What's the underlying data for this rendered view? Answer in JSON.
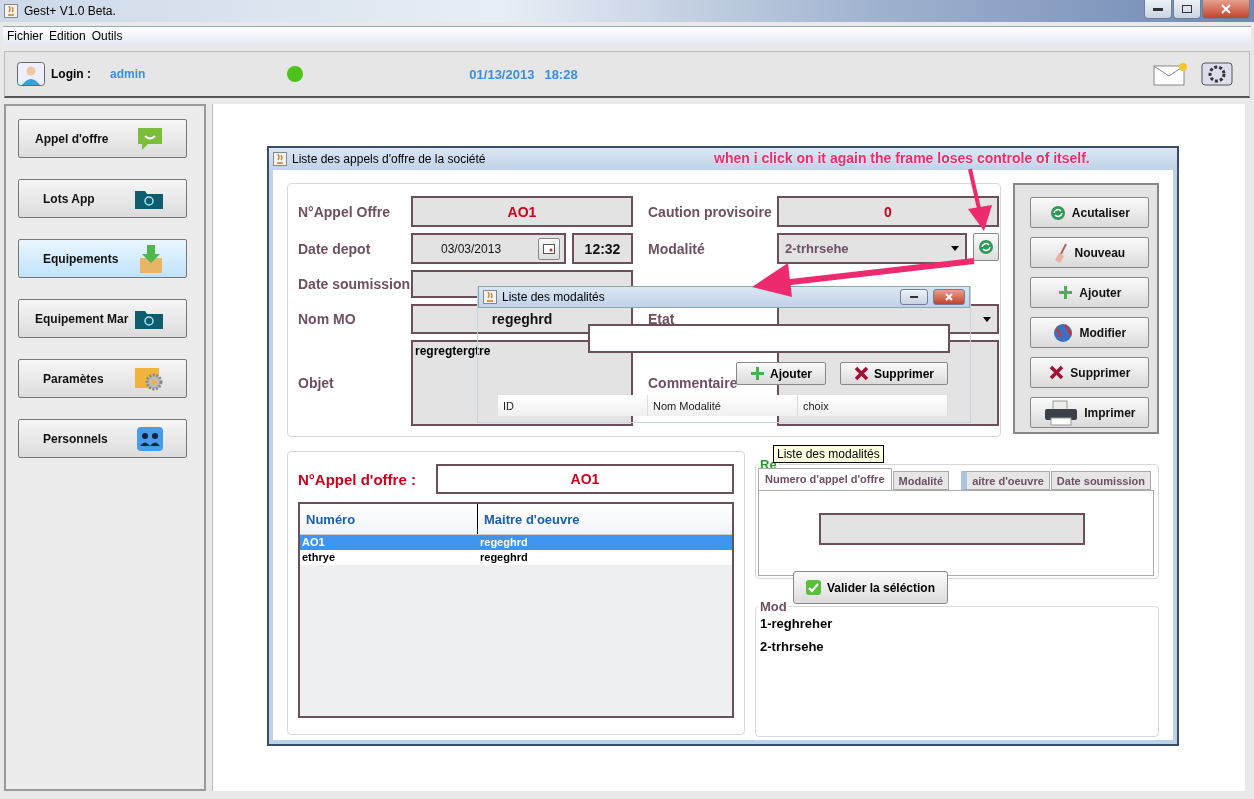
{
  "app_window": {
    "title": "Gest+ V1.0 Beta."
  },
  "menu": [
    "Fichier",
    "Edition",
    "Outils"
  ],
  "header": {
    "login_label": "Login :",
    "user": "admin",
    "date": "01/13/2013",
    "time": "18:28"
  },
  "sidebar": [
    {
      "label": "Appel d'offre",
      "kind": "chat",
      "selected": false
    },
    {
      "label": "Lots App",
      "kind": "folder",
      "selected": false
    },
    {
      "label": "Equipements",
      "kind": "box",
      "selected": true
    },
    {
      "label": "Equipement Mar",
      "kind": "folder",
      "selected": false
    },
    {
      "label": "Paramètes",
      "kind": "gear",
      "selected": false
    },
    {
      "label": "Personnels",
      "kind": "people",
      "selected": false
    }
  ],
  "frame": {
    "title": "Liste des appels d'offre de la société",
    "form": {
      "numero": {
        "label": "N°Appel Offre",
        "value": "AO1"
      },
      "date_depot": {
        "label": "Date depot",
        "value": "03/03/2013",
        "time": "12:32"
      },
      "date_soumission": {
        "label": "Date soumission"
      },
      "nom_mo": {
        "label": "Nom MO",
        "value": "regeghrd"
      },
      "objet": {
        "label": "Objet",
        "value": "regregtergtre"
      },
      "caution": {
        "label": "Caution provisoire",
        "value": "0"
      },
      "modalite": {
        "label": "Modalité",
        "value": "2-trhrsehe"
      },
      "etat": {
        "label": "Etat"
      },
      "commentaire": {
        "label": "Commentaire"
      }
    },
    "actions": [
      {
        "label": "Acutaliser",
        "kind": "refresh"
      },
      {
        "label": "Nouveau",
        "kind": "broom"
      },
      {
        "label": "Ajouter",
        "kind": "plus"
      },
      {
        "label": "Modifier",
        "kind": "globe"
      },
      {
        "label": "Supprimer",
        "kind": "cross"
      },
      {
        "label": "Imprimer",
        "kind": "printer"
      }
    ],
    "search": {
      "label": "N°Appel d'offre :",
      "value": "AO1"
    },
    "table": {
      "columns": [
        "Numéro",
        "Maitre d'oeuvre"
      ],
      "rows": [
        {
          "cells": [
            "AO1",
            "regeghrd"
          ],
          "selected": true
        },
        {
          "cells": [
            "ethrye",
            "regeghrd"
          ],
          "selected": false
        }
      ]
    },
    "search_group": {
      "title": "Re",
      "tabs": [
        {
          "label": "Numero d'appel d'offre",
          "selected": true
        },
        {
          "label": "Modalité",
          "selected": false
        },
        {
          "label": "aitre d'oeuvre",
          "selected": false
        },
        {
          "label": "Date soumission",
          "selected": false
        }
      ]
    },
    "modalites": {
      "title": "Mod",
      "items": [
        "1-reghreher",
        "2-trhrsehe"
      ]
    }
  },
  "popup": {
    "title": "Liste des modalités",
    "buttons": [
      {
        "label": "Ajouter",
        "kind": "plus"
      },
      {
        "label": "Supprimer",
        "kind": "cross"
      }
    ],
    "columns": [
      "ID",
      "Nom Modalité",
      "choix"
    ]
  },
  "tooltip": "Liste des modalités",
  "validate_button": "Valider la séléction",
  "annotation": "when i click on it again the frame loses controle of itself."
}
